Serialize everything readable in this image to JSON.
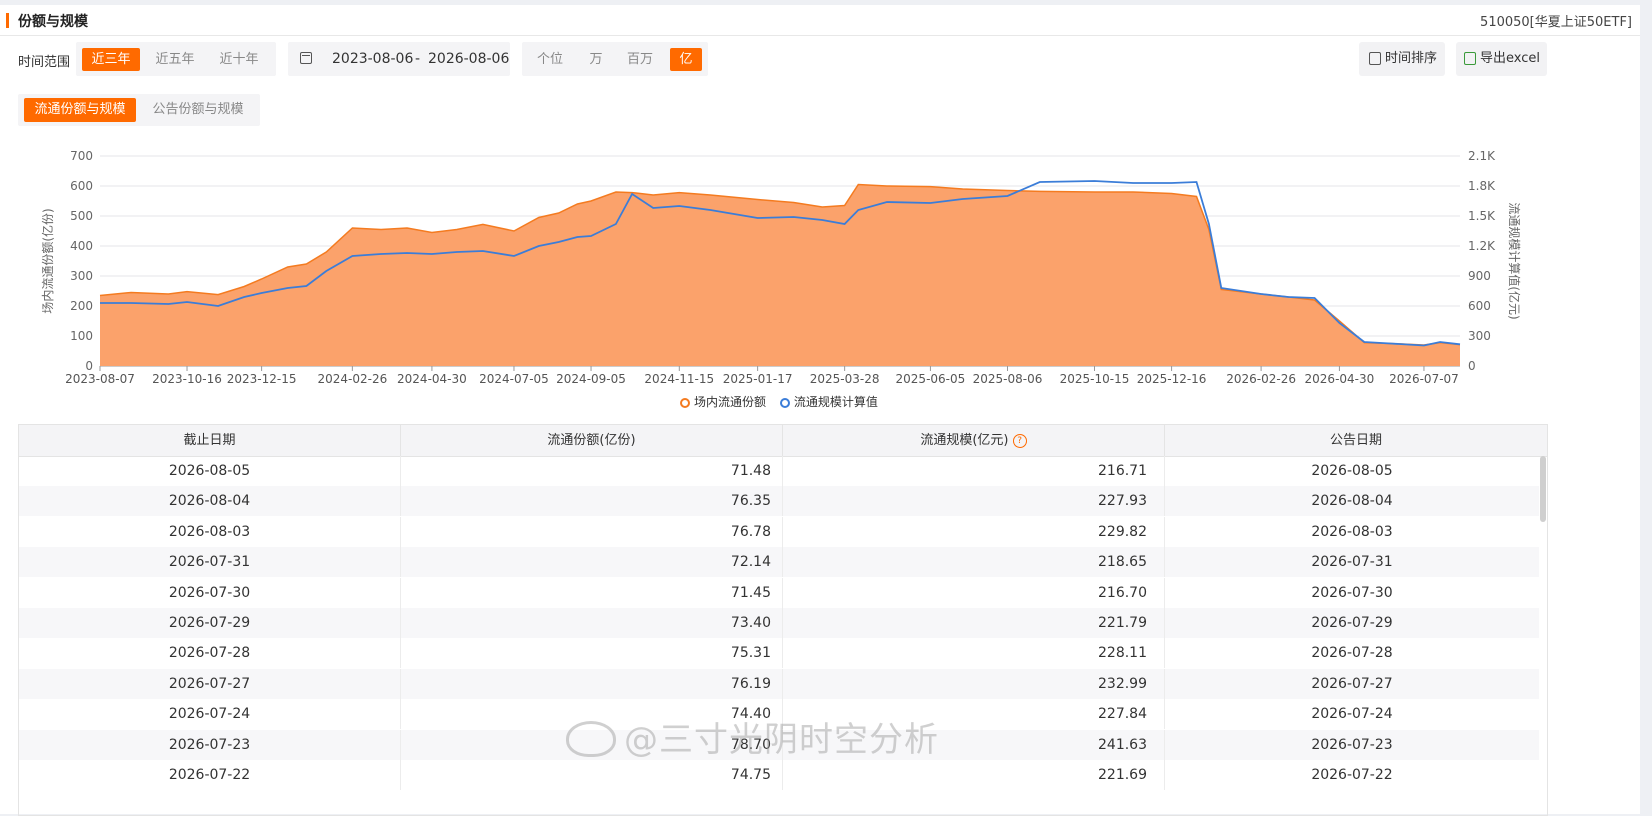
{
  "header": {
    "title": "份额与规模",
    "code": "510050[华夏上证50ETF]"
  },
  "range": {
    "label": "时间范围",
    "options": [
      "近三年",
      "近五年",
      "近十年"
    ],
    "selected": "近三年"
  },
  "dates": {
    "start": "2023-08-06",
    "sep": "-",
    "end": "2026-08-06"
  },
  "units": {
    "options": [
      "个位",
      "万",
      "百万",
      "亿"
    ],
    "selected": "亿"
  },
  "buttons": {
    "sort": "时间排序",
    "export": "导出excel"
  },
  "tabs": {
    "items": [
      "流通份额与规模",
      "公告份额与规模"
    ],
    "selected": "流通份额与规模"
  },
  "colors": {
    "accent": "#ff6a00",
    "area_fill": "#fba26b",
    "area_line": "#f47b20",
    "line": "#3b7dd8"
  },
  "chart_data": {
    "type": "area",
    "x_ticks": [
      "2023-08-07",
      "2023-10-16",
      "2023-12-15",
      "2024-02-26",
      "2024-04-30",
      "2024-07-05",
      "2024-09-05",
      "2024-11-15",
      "2025-01-17",
      "2025-03-28",
      "2025-06-05",
      "2025-08-06",
      "2025-10-15",
      "2025-12-16",
      "2026-02-26",
      "2026-04-30",
      "2026-07-07"
    ],
    "ylabel_left": "场内流通份额(亿份)",
    "ylabel_right": "流通规模计算值(亿元)",
    "y_left_ticks": [
      "0",
      "100",
      "200",
      "300",
      "400",
      "500",
      "600",
      "700"
    ],
    "y_right_ticks": [
      "0",
      "300",
      "600",
      "900",
      "1.2K",
      "1.5K",
      "1.8K",
      "2.1K"
    ],
    "ylim_left": [
      0,
      700
    ],
    "ylim_right": [
      0,
      2100
    ],
    "x_range": [
      "2023-08-07",
      "2026-08-05"
    ],
    "series": [
      {
        "name": "场内流通份额",
        "axis": "left",
        "points": [
          [
            "2023-08-07",
            235
          ],
          [
            "2023-09-01",
            245
          ],
          [
            "2023-10-01",
            240
          ],
          [
            "2023-10-16",
            248
          ],
          [
            "2023-11-10",
            238
          ],
          [
            "2023-12-01",
            265
          ],
          [
            "2023-12-15",
            290
          ],
          [
            "2024-01-05",
            330
          ],
          [
            "2024-01-20",
            340
          ],
          [
            "2024-02-05",
            380
          ],
          [
            "2024-02-26",
            460
          ],
          [
            "2024-03-20",
            455
          ],
          [
            "2024-04-10",
            460
          ],
          [
            "2024-04-30",
            445
          ],
          [
            "2024-05-20",
            455
          ],
          [
            "2024-06-10",
            472
          ],
          [
            "2024-07-05",
            450
          ],
          [
            "2024-07-25",
            495
          ],
          [
            "2024-08-10",
            510
          ],
          [
            "2024-08-25",
            540
          ],
          [
            "2024-09-05",
            550
          ],
          [
            "2024-09-25",
            580
          ],
          [
            "2024-10-08",
            578
          ],
          [
            "2024-10-25",
            570
          ],
          [
            "2024-11-15",
            578
          ],
          [
            "2024-12-10",
            570
          ],
          [
            "2025-01-17",
            555
          ],
          [
            "2025-02-15",
            545
          ],
          [
            "2025-03-10",
            530
          ],
          [
            "2025-03-28",
            535
          ],
          [
            "2025-04-08",
            605
          ],
          [
            "2025-05-01",
            600
          ],
          [
            "2025-06-05",
            598
          ],
          [
            "2025-07-01",
            590
          ],
          [
            "2025-08-06",
            585
          ],
          [
            "2025-09-01",
            582
          ],
          [
            "2025-10-15",
            580
          ],
          [
            "2025-11-15",
            580
          ],
          [
            "2025-12-16",
            575
          ],
          [
            "2026-01-05",
            565
          ],
          [
            "2026-01-15",
            455
          ],
          [
            "2026-01-25",
            255
          ],
          [
            "2026-02-26",
            240
          ],
          [
            "2026-03-20",
            230
          ],
          [
            "2026-04-10",
            220
          ],
          [
            "2026-04-30",
            150
          ],
          [
            "2026-05-20",
            78
          ],
          [
            "2026-06-10",
            75
          ],
          [
            "2026-07-07",
            70
          ],
          [
            "2026-07-20",
            78
          ],
          [
            "2026-08-05",
            71.48
          ]
        ]
      },
      {
        "name": "流通规模计算值",
        "axis": "right",
        "points": [
          [
            "2023-08-07",
            630
          ],
          [
            "2023-09-01",
            630
          ],
          [
            "2023-10-01",
            620
          ],
          [
            "2023-10-16",
            640
          ],
          [
            "2023-11-10",
            600
          ],
          [
            "2023-12-01",
            690
          ],
          [
            "2023-12-15",
            730
          ],
          [
            "2024-01-05",
            780
          ],
          [
            "2024-01-20",
            800
          ],
          [
            "2024-02-05",
            950
          ],
          [
            "2024-02-26",
            1100
          ],
          [
            "2024-03-20",
            1120
          ],
          [
            "2024-04-10",
            1130
          ],
          [
            "2024-04-30",
            1120
          ],
          [
            "2024-05-20",
            1140
          ],
          [
            "2024-06-10",
            1150
          ],
          [
            "2024-07-05",
            1100
          ],
          [
            "2024-07-25",
            1200
          ],
          [
            "2024-08-10",
            1240
          ],
          [
            "2024-08-25",
            1290
          ],
          [
            "2024-09-05",
            1300
          ],
          [
            "2024-09-25",
            1420
          ],
          [
            "2024-10-08",
            1720
          ],
          [
            "2024-10-25",
            1580
          ],
          [
            "2024-11-15",
            1600
          ],
          [
            "2024-12-10",
            1560
          ],
          [
            "2025-01-17",
            1480
          ],
          [
            "2025-02-15",
            1490
          ],
          [
            "2025-03-10",
            1460
          ],
          [
            "2025-03-28",
            1420
          ],
          [
            "2025-04-08",
            1560
          ],
          [
            "2025-05-01",
            1640
          ],
          [
            "2025-06-05",
            1630
          ],
          [
            "2025-07-01",
            1670
          ],
          [
            "2025-08-06",
            1700
          ],
          [
            "2025-09-01",
            1840
          ],
          [
            "2025-10-15",
            1850
          ],
          [
            "2025-11-15",
            1830
          ],
          [
            "2025-12-16",
            1830
          ],
          [
            "2026-01-05",
            1840
          ],
          [
            "2026-01-15",
            1420
          ],
          [
            "2026-01-25",
            780
          ],
          [
            "2026-02-26",
            720
          ],
          [
            "2026-03-20",
            690
          ],
          [
            "2026-04-10",
            680
          ],
          [
            "2026-04-30",
            430
          ],
          [
            "2026-05-20",
            240
          ],
          [
            "2026-06-10",
            225
          ],
          [
            "2026-07-07",
            205
          ],
          [
            "2026-07-20",
            240
          ],
          [
            "2026-08-05",
            216.71
          ]
        ]
      }
    ]
  },
  "table": {
    "headers": [
      "截止日期",
      "流通份额(亿份)",
      "流通规模(亿元)",
      "公告日期"
    ],
    "help_icon": "question-circle-icon",
    "rows": [
      [
        "2026-08-05",
        "71.48",
        "216.71",
        "2026-08-05"
      ],
      [
        "2026-08-04",
        "76.35",
        "227.93",
        "2026-08-04"
      ],
      [
        "2026-08-03",
        "76.78",
        "229.82",
        "2026-08-03"
      ],
      [
        "2026-07-31",
        "72.14",
        "218.65",
        "2026-07-31"
      ],
      [
        "2026-07-30",
        "71.45",
        "216.70",
        "2026-07-30"
      ],
      [
        "2026-07-29",
        "73.40",
        "221.79",
        "2026-07-29"
      ],
      [
        "2026-07-28",
        "75.31",
        "228.11",
        "2026-07-28"
      ],
      [
        "2026-07-27",
        "76.19",
        "232.99",
        "2026-07-27"
      ],
      [
        "2026-07-24",
        "74.40",
        "227.84",
        "2026-07-24"
      ],
      [
        "2026-07-23",
        "78.70",
        "241.63",
        "2026-07-23"
      ],
      [
        "2026-07-22",
        "74.75",
        "221.69",
        "2026-07-22"
      ]
    ]
  },
  "watermark": "@三寸光阴时空分析"
}
